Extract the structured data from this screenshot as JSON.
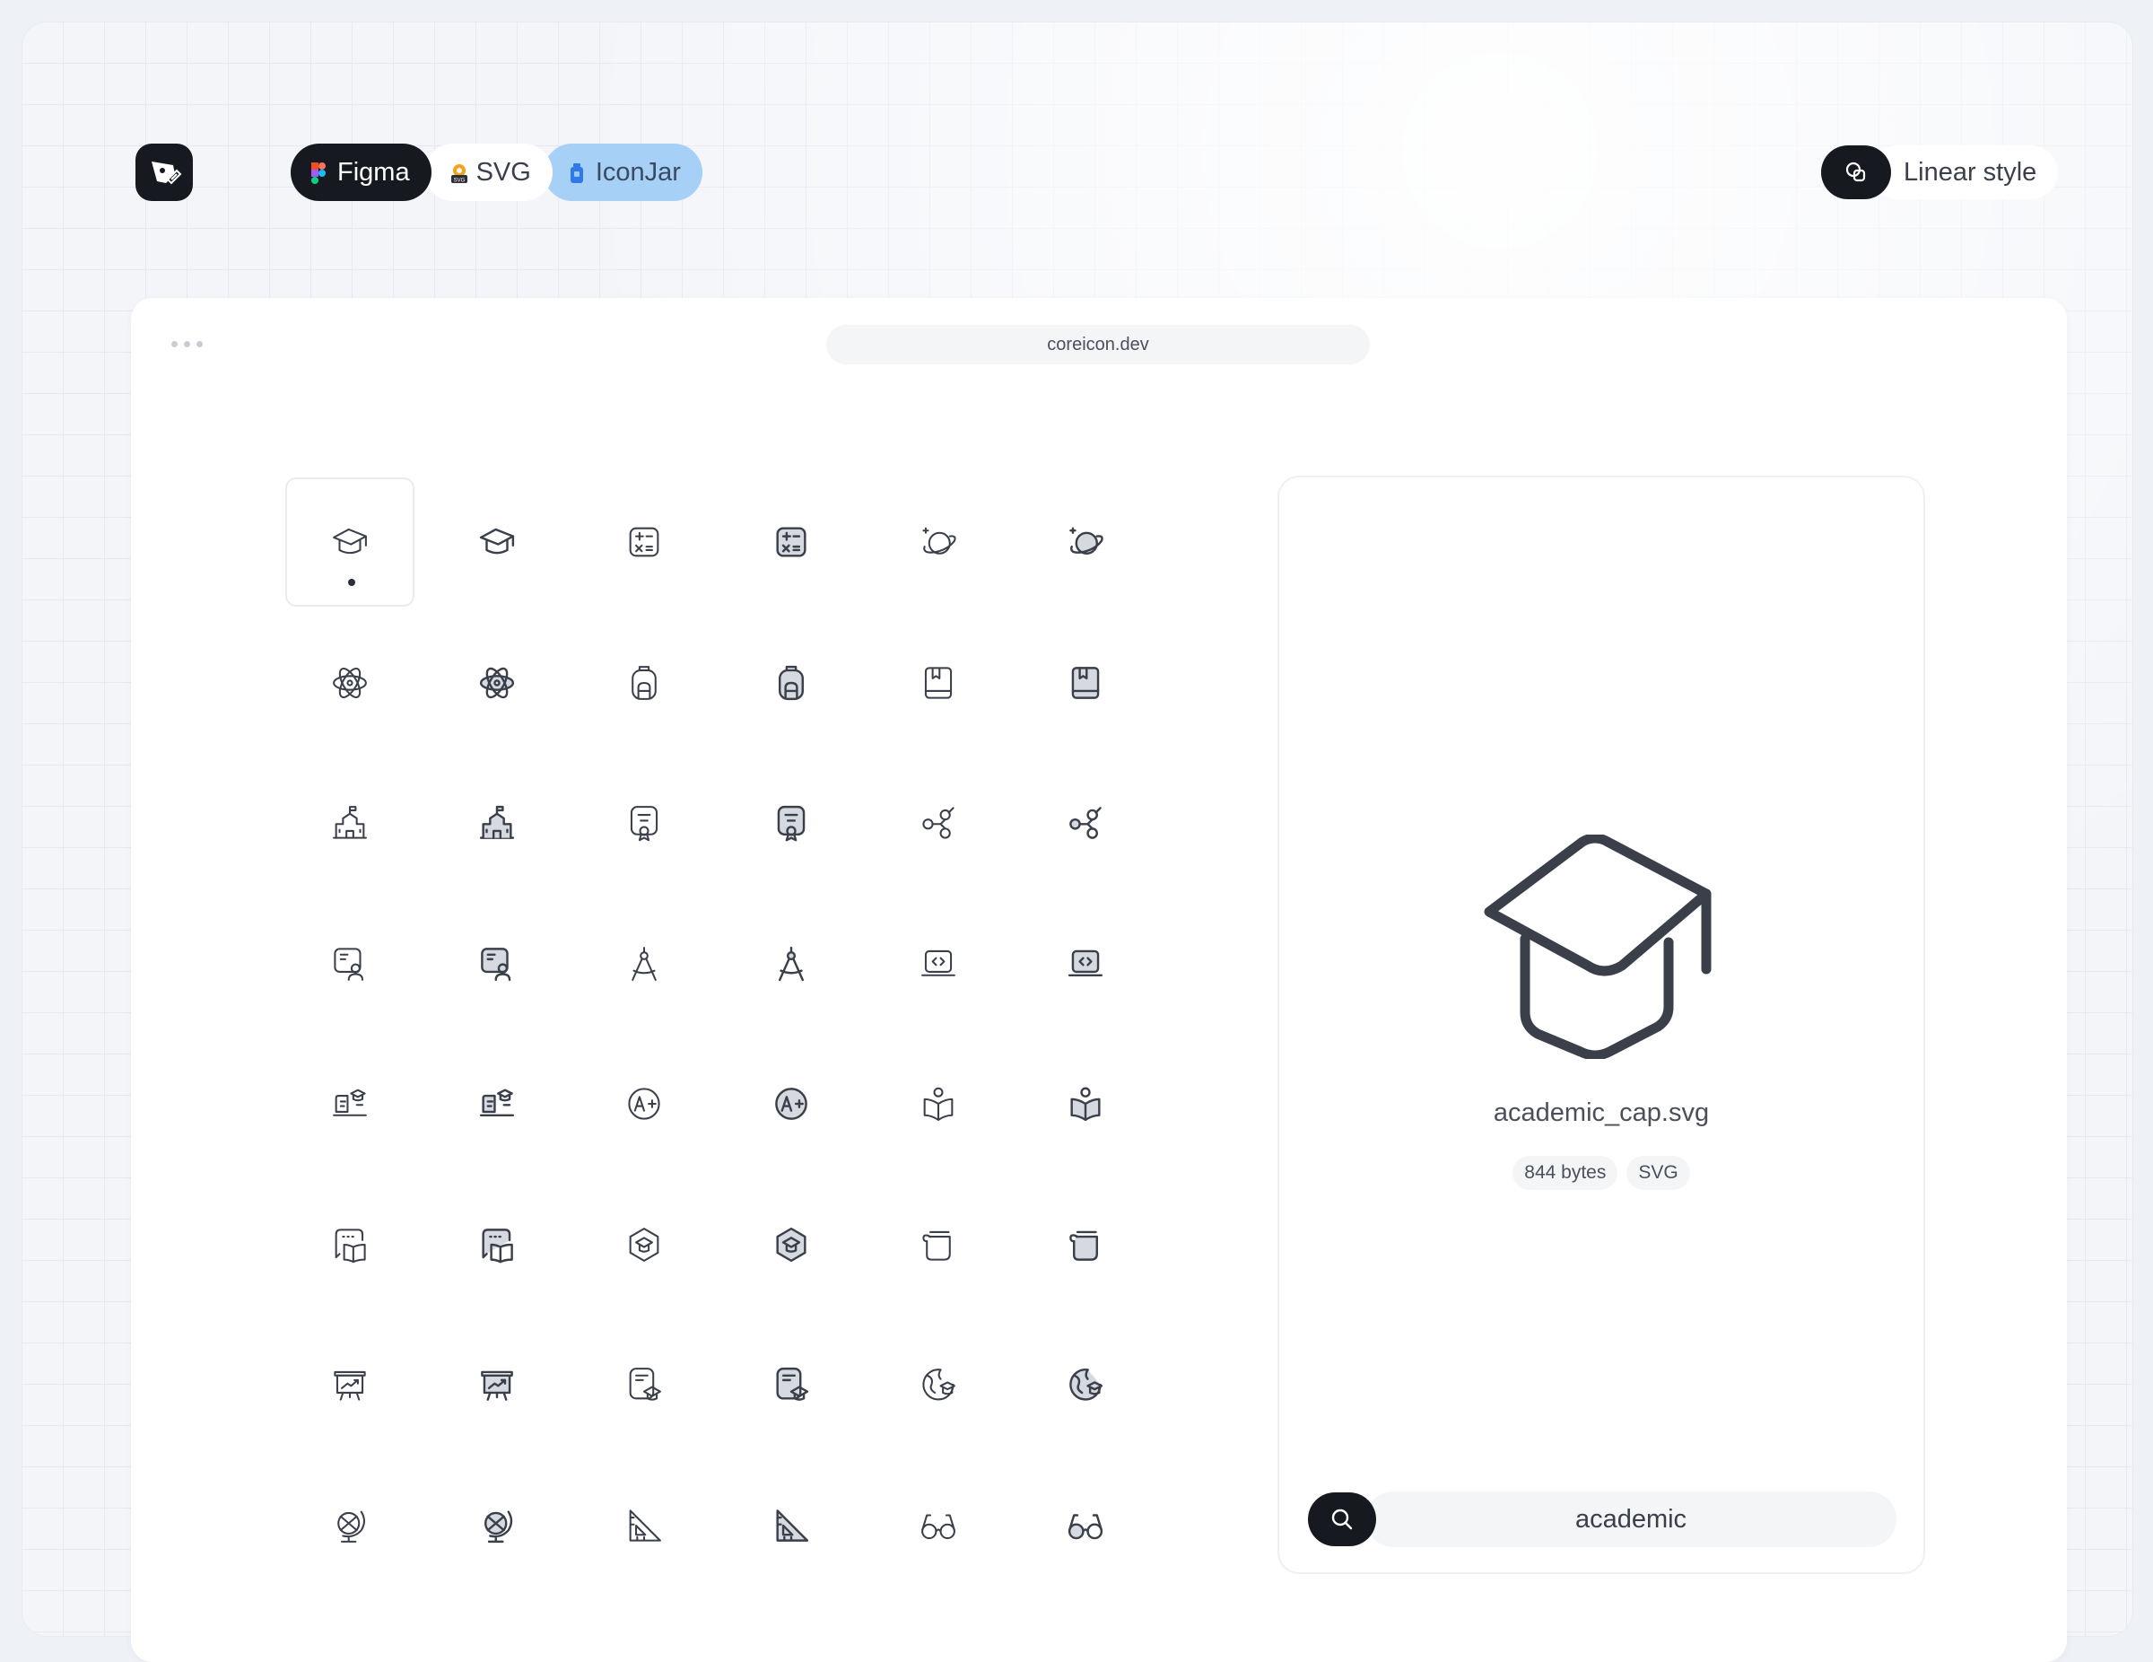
{
  "header": {
    "logo": "pen-logo-icon",
    "tabs": [
      {
        "label": "Figma",
        "icon": "figma-icon"
      },
      {
        "label": "SVG",
        "icon": "svg-file-icon"
      },
      {
        "label": "IconJar",
        "icon": "iconjar-icon"
      }
    ],
    "style_toggle": {
      "label": "Linear style",
      "icon": "shapes-icon"
    }
  },
  "browser": {
    "url": "coreicon.dev"
  },
  "icons": [
    {
      "name": "academic-cap-icon",
      "style": "linear",
      "selected": true
    },
    {
      "name": "academic-cap-icon",
      "style": "bold"
    },
    {
      "name": "calculator-icon",
      "style": "linear"
    },
    {
      "name": "calculator-icon",
      "style": "bold"
    },
    {
      "name": "planet-icon",
      "style": "linear"
    },
    {
      "name": "planet-icon",
      "style": "bold"
    },
    {
      "name": "atom-icon",
      "style": "linear"
    },
    {
      "name": "atom-icon",
      "style": "bold"
    },
    {
      "name": "backpack-icon",
      "style": "linear"
    },
    {
      "name": "backpack-icon",
      "style": "bold"
    },
    {
      "name": "book-icon",
      "style": "linear"
    },
    {
      "name": "book-icon",
      "style": "bold"
    },
    {
      "name": "school-building-icon",
      "style": "linear"
    },
    {
      "name": "school-building-icon",
      "style": "bold"
    },
    {
      "name": "certificate-icon",
      "style": "linear"
    },
    {
      "name": "certificate-icon",
      "style": "bold"
    },
    {
      "name": "molecule-icon",
      "style": "linear"
    },
    {
      "name": "molecule-icon",
      "style": "bold"
    },
    {
      "name": "student-board-icon",
      "style": "linear"
    },
    {
      "name": "student-board-icon",
      "style": "bold"
    },
    {
      "name": "compass-tool-icon",
      "style": "linear"
    },
    {
      "name": "compass-tool-icon",
      "style": "bold"
    },
    {
      "name": "laptop-code-icon",
      "style": "linear"
    },
    {
      "name": "laptop-code-icon",
      "style": "bold"
    },
    {
      "name": "online-course-icon",
      "style": "linear"
    },
    {
      "name": "online-course-icon",
      "style": "bold"
    },
    {
      "name": "grade-a-plus-icon",
      "style": "linear"
    },
    {
      "name": "grade-a-plus-icon",
      "style": "bold"
    },
    {
      "name": "reading-person-icon",
      "style": "linear"
    },
    {
      "name": "reading-person-icon",
      "style": "bold"
    },
    {
      "name": "book-chat-icon",
      "style": "linear"
    },
    {
      "name": "book-chat-icon",
      "style": "bold"
    },
    {
      "name": "education-badge-icon",
      "style": "linear"
    },
    {
      "name": "education-badge-icon",
      "style": "bold"
    },
    {
      "name": "scroll-paper-icon",
      "style": "linear"
    },
    {
      "name": "scroll-paper-icon",
      "style": "bold"
    },
    {
      "name": "presentation-board-icon",
      "style": "linear"
    },
    {
      "name": "presentation-board-icon",
      "style": "bold"
    },
    {
      "name": "diploma-document-icon",
      "style": "linear"
    },
    {
      "name": "diploma-document-icon",
      "style": "bold"
    },
    {
      "name": "global-education-icon",
      "style": "linear"
    },
    {
      "name": "global-education-icon",
      "style": "bold"
    },
    {
      "name": "globe-stand-icon",
      "style": "linear"
    },
    {
      "name": "globe-stand-icon",
      "style": "bold"
    },
    {
      "name": "triangle-ruler-icon",
      "style": "linear"
    },
    {
      "name": "triangle-ruler-icon",
      "style": "bold"
    },
    {
      "name": "glasses-icon",
      "style": "linear"
    },
    {
      "name": "glasses-icon",
      "style": "bold"
    }
  ],
  "preview": {
    "icon": "academic-cap-icon",
    "file_name": "academic_cap.svg",
    "size": "844 bytes",
    "format": "SVG"
  },
  "search": {
    "value": "academic",
    "icon": "search-icon"
  },
  "colors": {
    "dark": "#16191f",
    "accent_blue": "#a6d0f5",
    "icon_stroke": "#3a3f4a"
  }
}
